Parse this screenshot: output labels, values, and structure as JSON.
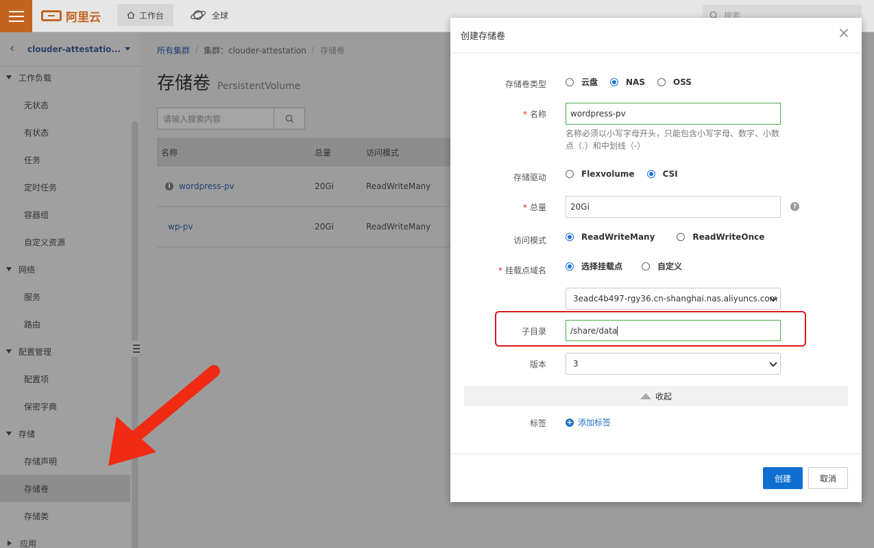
{
  "topbar": {
    "logo_text": "阿里云",
    "workspace_label": "工作台",
    "global_label": "全球",
    "search_placeholder": "搜索..."
  },
  "sidebar": {
    "cluster_name": "clouder-attestatio...",
    "groups": [
      {
        "label": "工作负载",
        "items": [
          "无状态",
          "有状态",
          "任务",
          "定时任务",
          "容器组",
          "自定义资源"
        ]
      },
      {
        "label": "网络",
        "items": [
          "服务",
          "路由"
        ]
      },
      {
        "label": "配置管理",
        "items": [
          "配置项",
          "保密字典"
        ]
      },
      {
        "label": "存储",
        "items": [
          "存储声明",
          "存储卷",
          "存储类"
        ]
      },
      {
        "label": "应用",
        "items": []
      }
    ],
    "active_item": "存储卷"
  },
  "main": {
    "breadcrumb": {
      "root": "所有集群",
      "cluster": "集群：clouder-attestation",
      "current": "存储卷"
    },
    "title_zh": "存储卷",
    "title_en": "PersistentVolume",
    "search_placeholder": "请输入搜索内容",
    "table": {
      "headers": [
        "名称",
        "总量",
        "访问模式"
      ],
      "rows": [
        {
          "name": "wordpress-pv",
          "capacity": "20Gi",
          "mode": "ReadWriteMany"
        },
        {
          "name": "wp-pv",
          "capacity": "20Gi",
          "mode": "ReadWriteMany"
        }
      ]
    }
  },
  "dialog": {
    "title": "创建存储卷",
    "type_label": "存储卷类型",
    "type_options": [
      "云盘",
      "NAS",
      "OSS"
    ],
    "type_selected": "NAS",
    "name_label": "名称",
    "name_value": "wordpress-pv",
    "name_hint": "名称必须以小写字母开头，只能包含小写字母、数字、小数点（.）和中划线（-）",
    "driver_label": "存储驱动",
    "driver_options": [
      "Flexvolume",
      "CSI"
    ],
    "driver_selected": "CSI",
    "capacity_label": "总量",
    "capacity_value": "20Gi",
    "access_label": "访问模式",
    "access_options": [
      "ReadWriteMany",
      "ReadWriteOnce"
    ],
    "access_selected": "ReadWriteMany",
    "mount_label": "挂载点域名",
    "mount_options": [
      "选择挂载点",
      "自定义"
    ],
    "mount_selected": "选择挂载点",
    "mount_value": "3eadc4b497-rgy36.cn-shanghai.nas.aliyuncs.com",
    "subdir_label": "子目录",
    "subdir_value": "/share/data",
    "version_label": "版本",
    "version_value": "3",
    "collapse_label": "收起",
    "tag_label": "标签",
    "add_tag_label": "添加标签",
    "create_label": "创建",
    "cancel_label": "取消"
  },
  "colors": {
    "brand_orange": "#c4631f",
    "primary_blue": "#0e6fd1",
    "highlight_red": "#e0151b",
    "input_green": "#4caa48",
    "arrow_red": "#f12a14"
  }
}
